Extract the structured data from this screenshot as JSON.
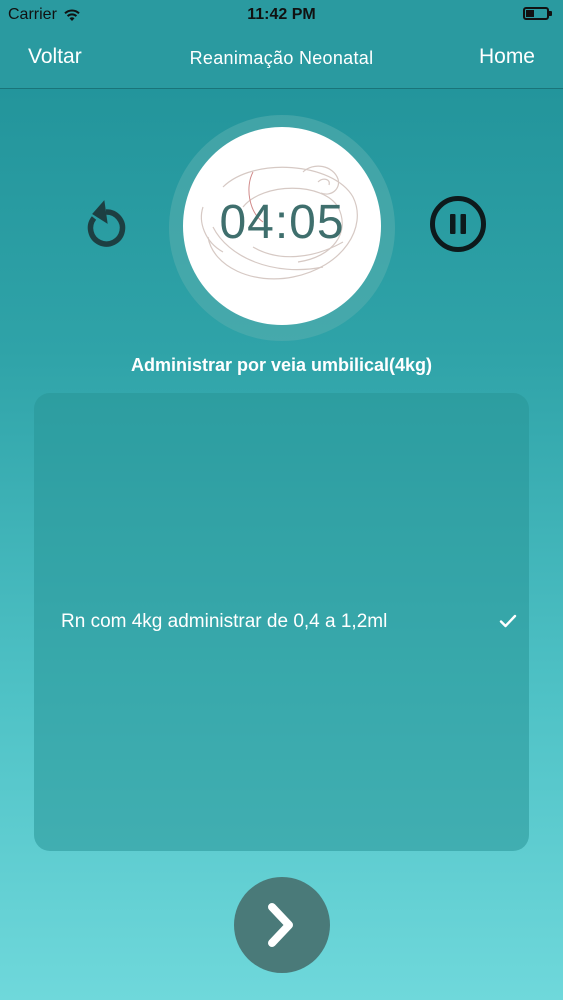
{
  "status_bar": {
    "carrier": "Carrier",
    "time": "11:42 PM"
  },
  "nav": {
    "back_label": "Voltar",
    "title": "Reanimação Neonatal",
    "home_label": "Home"
  },
  "timer": {
    "value": "04:05"
  },
  "instruction": "Administrar por veia umbilical(4kg)",
  "options": [
    {
      "label": "Rn com 4kg administrar de 0,4 a 1,2ml",
      "checked": true
    }
  ],
  "icons": {
    "wifi": "wifi-icon",
    "battery": "battery-icon",
    "reset": "reset-icon",
    "pause": "pause-icon",
    "check": "checkmark-icon",
    "next": "chevron-right-icon"
  },
  "colors": {
    "nav_background": "#2a9aa0",
    "timer_text": "#3f6f6d",
    "next_button": "#4a7a79"
  }
}
